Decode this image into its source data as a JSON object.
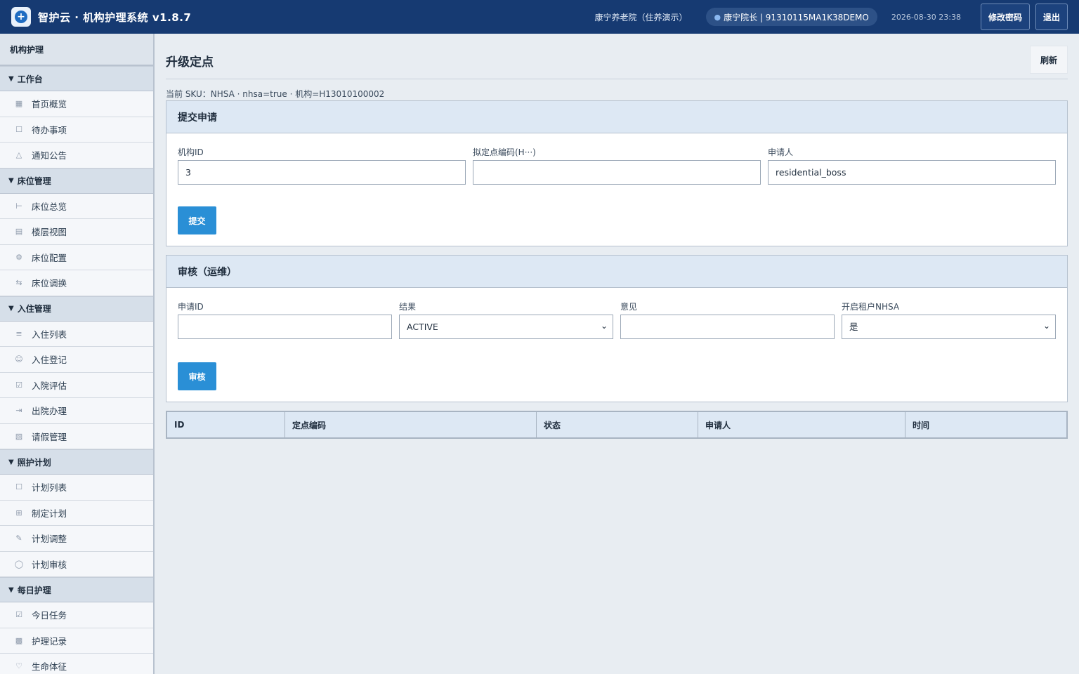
{
  "app": {
    "title": "智护云 · 机构护理系统 v1.8.7",
    "logo": "plus-circle-icon"
  },
  "topbar": {
    "org": "康宁养老院（住养演示）",
    "user": "康宁院长 | 91310115MA1K38DEMO",
    "datetime": "2026-08-30 23:38",
    "change_password": "修改密码",
    "logout": "退出"
  },
  "sidebar": {
    "header": "机构护理",
    "groups": [
      {
        "label": "工作台",
        "items": [
          {
            "label": "首页概览",
            "icon": "grid-icon"
          },
          {
            "label": "待办事项",
            "icon": "clipboard-icon"
          },
          {
            "label": "通知公告",
            "icon": "bell-icon"
          }
        ]
      },
      {
        "label": "床位管理",
        "items": [
          {
            "label": "床位总览",
            "icon": "bed-icon"
          },
          {
            "label": "楼层视图",
            "icon": "building-icon"
          },
          {
            "label": "床位配置",
            "icon": "gear-icon"
          },
          {
            "label": "床位调换",
            "icon": "swap-icon"
          }
        ]
      },
      {
        "label": "入住管理",
        "items": [
          {
            "label": "入住列表",
            "icon": "list-icon"
          },
          {
            "label": "入住登记",
            "icon": "user-plus-icon"
          },
          {
            "label": "入院评估",
            "icon": "clipboard-check-icon"
          },
          {
            "label": "出院办理",
            "icon": "exit-icon"
          },
          {
            "label": "请假管理",
            "icon": "calendar-off-icon"
          }
        ]
      },
      {
        "label": "照护计划",
        "items": [
          {
            "label": "计划列表",
            "icon": "clipboard-icon"
          },
          {
            "label": "制定计划",
            "icon": "file-plus-icon"
          },
          {
            "label": "计划调整",
            "icon": "pencil-icon"
          },
          {
            "label": "计划审核",
            "icon": "shield-check-icon"
          }
        ]
      },
      {
        "label": "每日护理",
        "items": [
          {
            "label": "今日任务",
            "icon": "checkbox-icon"
          },
          {
            "label": "护理记录",
            "icon": "notebook-icon"
          },
          {
            "label": "生命体征",
            "icon": "heart-pulse-icon"
          }
        ]
      }
    ]
  },
  "page": {
    "title": "升级定点",
    "refresh": "刷新",
    "sku_info": "当前 SKU：NHSA · nhsa=true · 机构=H13010100002"
  },
  "submit_panel": {
    "title": "提交申请",
    "org_id_label": "机构ID",
    "org_id_value": "3",
    "code_label": "拟定点编码(H···)",
    "code_value": "",
    "applicant_label": "申请人",
    "applicant_value": "residential_boss",
    "submit": "提交"
  },
  "review_panel": {
    "title": "审核（运维）",
    "request_id_label": "申请ID",
    "request_id_value": "",
    "result_label": "结果",
    "result_value": "ACTIVE",
    "opinion_label": "意见",
    "opinion_value": "",
    "nhsa_label": "开启租户NHSA",
    "nhsa_value": "是",
    "review": "审核"
  },
  "table": {
    "columns": [
      "ID",
      "定点编码",
      "状态",
      "申请人",
      "时间"
    ]
  }
}
